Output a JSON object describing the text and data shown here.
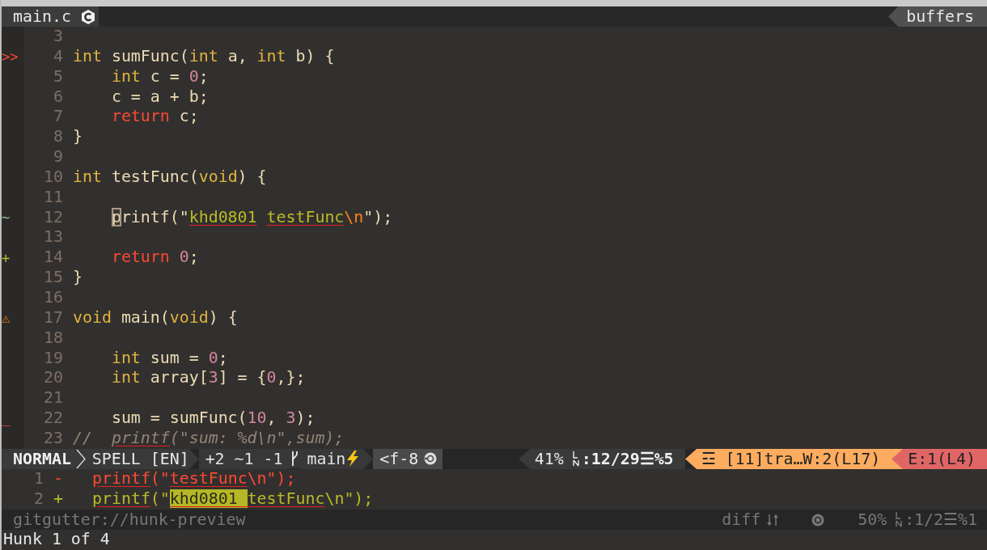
{
  "tabline": {
    "tabs": [
      {
        "label": "main.c",
        "selected": true
      }
    ],
    "buffers_label": "buffers"
  },
  "code_lines": [
    {
      "num": "3"
    },
    {
      "num": "4",
      "sign": {
        "text": ">>",
        "kind": "error"
      },
      "segs": [
        {
          "t": "int",
          "kind": "type"
        },
        {
          "t": " sumFunc(",
          "kind": "plain"
        },
        {
          "t": "int",
          "kind": "type"
        },
        {
          "t": " a, ",
          "kind": "plain"
        },
        {
          "t": "int",
          "kind": "type"
        },
        {
          "t": " b) {",
          "kind": "plain"
        }
      ]
    },
    {
      "num": "5",
      "segs": [
        {
          "t": "    int",
          "kind": "type"
        },
        {
          "t": " c = ",
          "kind": "plain"
        },
        {
          "t": "0",
          "kind": "number"
        },
        {
          "t": ";",
          "kind": "plain"
        }
      ]
    },
    {
      "num": "6",
      "segs": [
        {
          "t": "    c = a + b;",
          "kind": "plain"
        }
      ]
    },
    {
      "num": "7",
      "segs": [
        {
          "t": "    return",
          "kind": "keyword"
        },
        {
          "t": " c;",
          "kind": "plain"
        }
      ]
    },
    {
      "num": "8",
      "segs": [
        {
          "t": "}",
          "kind": "plain"
        }
      ]
    },
    {
      "num": "9"
    },
    {
      "num": "10",
      "segs": [
        {
          "t": "int",
          "kind": "type"
        },
        {
          "t": " testFunc(",
          "kind": "plain"
        },
        {
          "t": "void",
          "kind": "type"
        },
        {
          "t": ") {",
          "kind": "plain"
        }
      ]
    },
    {
      "num": "11"
    },
    {
      "num": "12",
      "sign": {
        "text": "~",
        "kind": "changed"
      },
      "segs": [
        {
          "t": "    p",
          "kind": "plain",
          "cursor": true
        },
        {
          "t": "rintf(\"",
          "kind": "plain"
        },
        {
          "t": "khd0801",
          "kind": "string",
          "spell": true
        },
        {
          "t": " testFunc",
          "kind": "string",
          "spell": true
        },
        {
          "t": "\\n",
          "kind": "escape"
        },
        {
          "t": "\");",
          "kind": "plain"
        }
      ]
    },
    {
      "num": "13"
    },
    {
      "num": "14",
      "sign": {
        "text": "+",
        "kind": "added"
      },
      "segs": [
        {
          "t": "    return",
          "kind": "keyword"
        },
        {
          "t": " 0",
          "kind": "number"
        },
        {
          "t": ";",
          "kind": "plain"
        }
      ]
    },
    {
      "num": "15",
      "segs": [
        {
          "t": "}",
          "kind": "plain"
        }
      ]
    },
    {
      "num": "16"
    },
    {
      "num": "17",
      "sign": {
        "text": "⚠",
        "kind": "warning"
      },
      "segs": [
        {
          "t": "void",
          "kind": "type"
        },
        {
          "t": " main(",
          "kind": "plain"
        },
        {
          "t": "void",
          "kind": "type"
        },
        {
          "t": ") {",
          "kind": "plain"
        }
      ]
    },
    {
      "num": "18"
    },
    {
      "num": "19",
      "segs": [
        {
          "t": "    int",
          "kind": "type"
        },
        {
          "t": " sum = ",
          "kind": "plain"
        },
        {
          "t": "0",
          "kind": "number"
        },
        {
          "t": ";",
          "kind": "plain"
        }
      ]
    },
    {
      "num": "20",
      "segs": [
        {
          "t": "    int",
          "kind": "type"
        },
        {
          "t": " array[",
          "kind": "plain"
        },
        {
          "t": "3",
          "kind": "number"
        },
        {
          "t": "] = {",
          "kind": "plain"
        },
        {
          "t": "0",
          "kind": "number"
        },
        {
          "t": ",};",
          "kind": "plain"
        }
      ]
    },
    {
      "num": "21"
    },
    {
      "num": "22",
      "sign": {
        "text": "_",
        "kind": "removed"
      },
      "segs": [
        {
          "t": "    sum = sumFunc(",
          "kind": "plain"
        },
        {
          "t": "10",
          "kind": "number"
        },
        {
          "t": ", ",
          "kind": "plain"
        },
        {
          "t": "3",
          "kind": "number"
        },
        {
          "t": ");",
          "kind": "plain"
        }
      ]
    },
    {
      "num": "23",
      "segs": [
        {
          "t": "//",
          "kind": "comment"
        },
        {
          "t": "  printf",
          "kind": "comment",
          "spell": true
        },
        {
          "t": "(\"sum: %d\\n\",sum);",
          "kind": "comment"
        }
      ]
    }
  ],
  "statusline": {
    "mode": "NORMAL",
    "spell": "SPELL [EN]",
    "hunks": "+2 ~1 -1",
    "branch": "main",
    "encoding": "<f-8",
    "percent": "41%",
    "position": ":12/29",
    "column_sep": "☰",
    "column": "%5",
    "warnings": "☲ [11]tra…W:2(L17)",
    "errors": "E:1(L4)"
  },
  "preview_lines": [
    {
      "num": "1",
      "sign": "-",
      "kind": "removed",
      "segs": [
        {
          "t": "printf",
          "spell": true
        },
        {
          "t": "(\""
        },
        {
          "t": "testFunc",
          "spell": true
        },
        {
          "t": "\\n\");"
        }
      ]
    },
    {
      "num": "2",
      "sign": "+",
      "kind": "added",
      "segs": [
        {
          "t": "printf",
          "spell": true
        },
        {
          "t": "(\""
        },
        {
          "t": "khd0801 ",
          "spell": true,
          "highlight": true
        },
        {
          "t": "testFunc",
          "spell": true
        },
        {
          "t": "\\n\");"
        }
      ]
    }
  ],
  "preview_status": {
    "name": "gitgutter://hunk-preview",
    "filetype": "diff",
    "percent": "50%",
    "position": ":1/2",
    "column_sep": "☰",
    "column": "%1"
  },
  "command_line": "Hunk 1 of 4"
}
